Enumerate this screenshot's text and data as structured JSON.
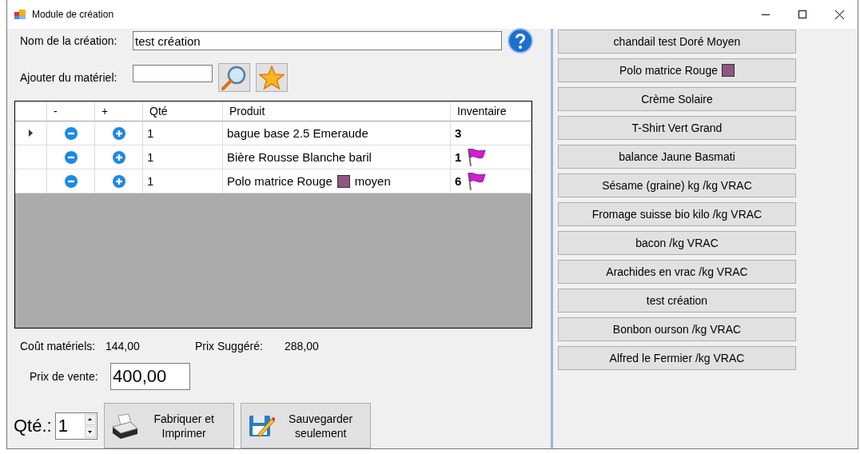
{
  "window": {
    "title": "Module de création"
  },
  "name_field": {
    "label": "Nom de la création:",
    "value": "test création"
  },
  "add_field": {
    "label": "Ajouter du matériel:"
  },
  "grid": {
    "columns": [
      "-",
      "+",
      "Qté",
      "Produit",
      "Inventaire"
    ],
    "rows": [
      {
        "current": true,
        "qty": "1",
        "product": "bague base 2.5 Emeraude",
        "swatch": false,
        "inventory": "3",
        "flagged": false
      },
      {
        "current": false,
        "qty": "1",
        "product": "Bière Rousse Blanche baril",
        "swatch": false,
        "inventory": "1",
        "flagged": true
      },
      {
        "current": false,
        "qty": "1",
        "product": "Polo matrice Rouge",
        "swatch": true,
        "product_after": "moyen",
        "inventory": "6",
        "flagged": true
      }
    ]
  },
  "totals": {
    "cost_label": "Coût matériels:",
    "cost": "144,00",
    "suggested_label": "Prix Suggéré:",
    "suggested": "288,00"
  },
  "sale_price": {
    "label": "Prix de vente:",
    "value": "400,00"
  },
  "quantity": {
    "label": "Qté.:",
    "value": "1"
  },
  "actions": [
    {
      "kind": "print",
      "label": "Fabriquer et Imprimer"
    },
    {
      "kind": "save",
      "label": "Sauvegarder seulement"
    }
  ],
  "products": [
    {
      "label": "chandail test Doré Moyen",
      "swatch": false
    },
    {
      "label": "Polo matrice Rouge",
      "swatch": true
    },
    {
      "label": "Crème Solaire",
      "swatch": false
    },
    {
      "label": "T-Shirt Vert Grand",
      "swatch": false
    },
    {
      "label": "balance Jaune Basmati",
      "swatch": false
    },
    {
      "label": "Sésame (graine) kg /kg VRAC",
      "swatch": false
    },
    {
      "label": "Fromage suisse bio kilo /kg VRAC",
      "swatch": false
    },
    {
      "label": "bacon /kg VRAC",
      "swatch": false
    },
    {
      "label": "Arachides en vrac /kg VRAC",
      "swatch": false
    },
    {
      "label": "test création",
      "swatch": false
    },
    {
      "label": "Bonbon ourson /kg VRAC",
      "swatch": false
    },
    {
      "label": "Alfred le Fermier /kg VRAC",
      "swatch": false
    }
  ]
}
